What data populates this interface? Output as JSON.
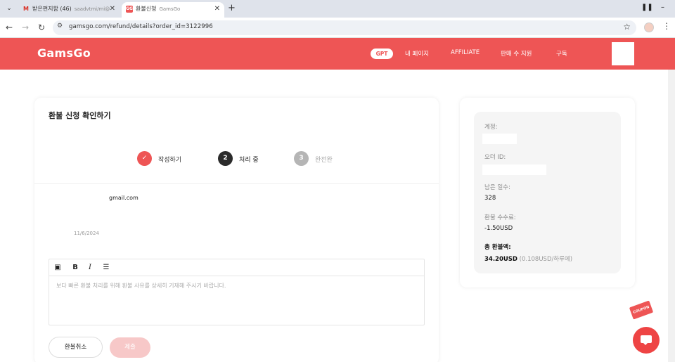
{
  "browser": {
    "tab_list_icon": "chevron-down-icon",
    "tabs": [
      {
        "title": "받은편지함 (46)",
        "subtitle": "saadvtmi/mi@",
        "active": false
      },
      {
        "title": "환불신청",
        "subtitle": "GamsGo",
        "active": true
      }
    ],
    "new_tab_label": "+",
    "url": "gamsgo.com/refund/details?order_id=3122996"
  },
  "site": {
    "brand_color": "#ee5555",
    "logo": "GamsGo",
    "nav": {
      "gpt": "GPT",
      "my_page": "내 페이지",
      "affiliate": "AFFILIATE",
      "seller_support": "판매 수 지원",
      "subscribe": "구독"
    }
  },
  "refund": {
    "title": "환불 신청 확인하기",
    "steps": [
      {
        "number": "✓",
        "label": "작성하기"
      },
      {
        "number": "2",
        "label": "처리 중"
      },
      {
        "number": "3",
        "label": "완전완"
      }
    ],
    "email": "gmail.com",
    "date": "11/6/2024",
    "editor": {
      "placeholder": "보다 빠른 환불 처리를 위해 환불 사유를 상세히 기재해 주시기 바랍니다.",
      "toolbar": [
        "image-icon",
        "bold-icon",
        "italic-icon",
        "list-icon"
      ]
    },
    "cancel_label": "환불취소",
    "submit_label": "제출"
  },
  "summary": {
    "account_label": "계정:",
    "order_id_label": "오더 ID:",
    "days_label": "남은 일수:",
    "days_value": "328",
    "fee_label": "환불 수수료:",
    "fee_value": "-1.50USD",
    "total_label": "총 환불액:",
    "total_value": "34.20USD",
    "total_note": "(0.108USD/하루에)"
  },
  "floating": {
    "coupon_label": "COUPON",
    "chat_icon": "chat-icon"
  }
}
